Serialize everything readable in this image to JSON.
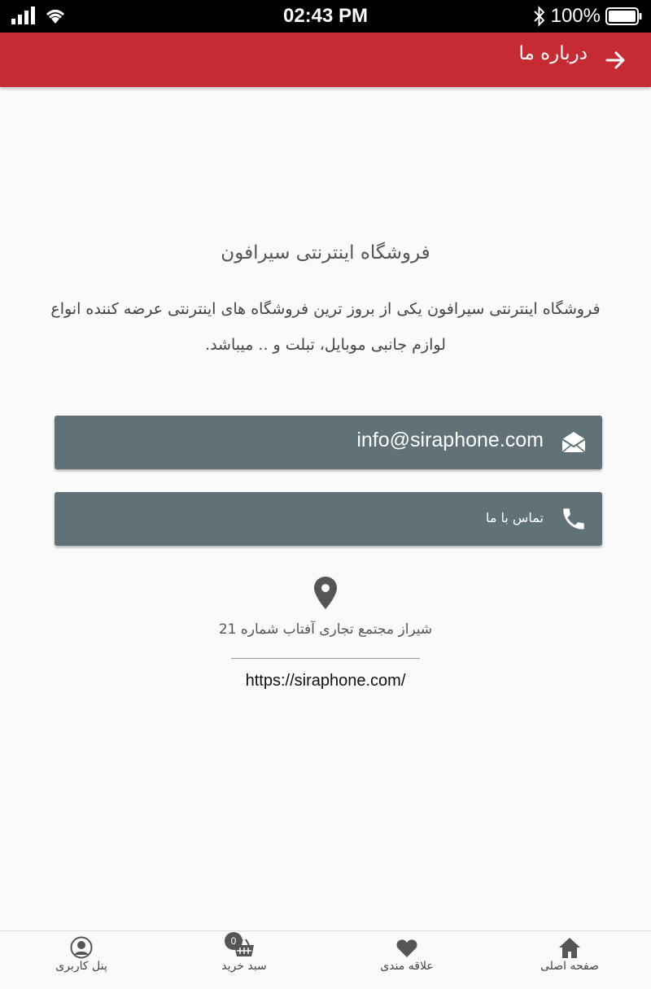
{
  "status_bar": {
    "time": "02:43 PM",
    "battery": "100%",
    "icons": [
      "signal-icon",
      "wifi-icon",
      "bluetooth-icon",
      "battery-icon"
    ]
  },
  "header": {
    "title": "درباره ما",
    "back_icon": "arrow-right-icon",
    "background": "#c62a33"
  },
  "about": {
    "title": "فروشگاه اینترنتی سیرافون",
    "description": "فروشگاه اینترنتی سیرافون یکی از بروز ترین فروشگاه های اینترنتی عرضه کننده انواع لوازم جانبی موبایل، تبلت و .. میباشد."
  },
  "contact": {
    "email": "info@siraphone.com",
    "email_icon": "envelope-icon",
    "phone_label": "تماس با ما",
    "phone_icon": "phone-icon",
    "button_color": "#607177"
  },
  "location": {
    "icon": "location-pin-icon",
    "address": "شیراز مجتمع تجاری آفتاب شماره 21"
  },
  "website": "https://siraphone.com/",
  "bottom_nav": {
    "items": [
      {
        "label": "پنل کاربری",
        "icon": "user-icon"
      },
      {
        "label": "سبد خرید",
        "icon": "basket-icon",
        "badge": "0"
      },
      {
        "label": "علاقه مندی",
        "icon": "heart-icon"
      },
      {
        "label": "صفحه اصلی",
        "icon": "home-icon"
      }
    ]
  }
}
